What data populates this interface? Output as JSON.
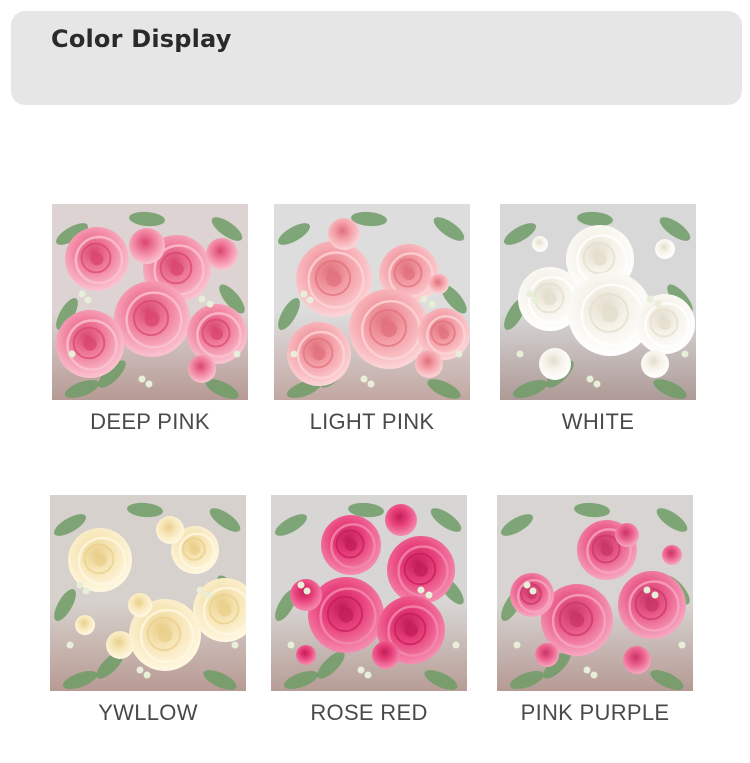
{
  "header": {
    "title": "Color Display"
  },
  "colors": [
    {
      "label": "DEEP PINK",
      "petal": "#f07f9c",
      "petal_light": "#fbc4d2",
      "center": "#d9456f",
      "bg_top": "#dcd3d2",
      "bg_bottom": "#b69a95"
    },
    {
      "label": "LIGHT PINK",
      "petal": "#f4a0a8",
      "petal_light": "#fcd6d8",
      "center": "#e0707c",
      "bg_top": "#dddddd",
      "bg_bottom": "#c2a7a2"
    },
    {
      "label": "WHITE",
      "petal": "#f6f3ea",
      "petal_light": "#ffffff",
      "center": "#e3ddcc",
      "bg_top": "#d8d8d8",
      "bg_bottom": "#ae9a96"
    },
    {
      "label": "YWLLOW",
      "petal": "#f7e6b8",
      "petal_light": "#fff8e2",
      "center": "#e9cf8a",
      "bg_top": "#d6d1cc",
      "bg_bottom": "#b99a94"
    },
    {
      "label": "ROSE RED",
      "petal": "#e8407a",
      "petal_light": "#f58cb0",
      "center": "#c31d57",
      "bg_top": "#d8d6d4",
      "bg_bottom": "#b79d96"
    },
    {
      "label": "PINK PURPLE",
      "petal": "#ea5c8a",
      "petal_light": "#f7a8c2",
      "center": "#c93468",
      "bg_top": "#d7d4d2",
      "bg_bottom": "#b69a94"
    }
  ]
}
